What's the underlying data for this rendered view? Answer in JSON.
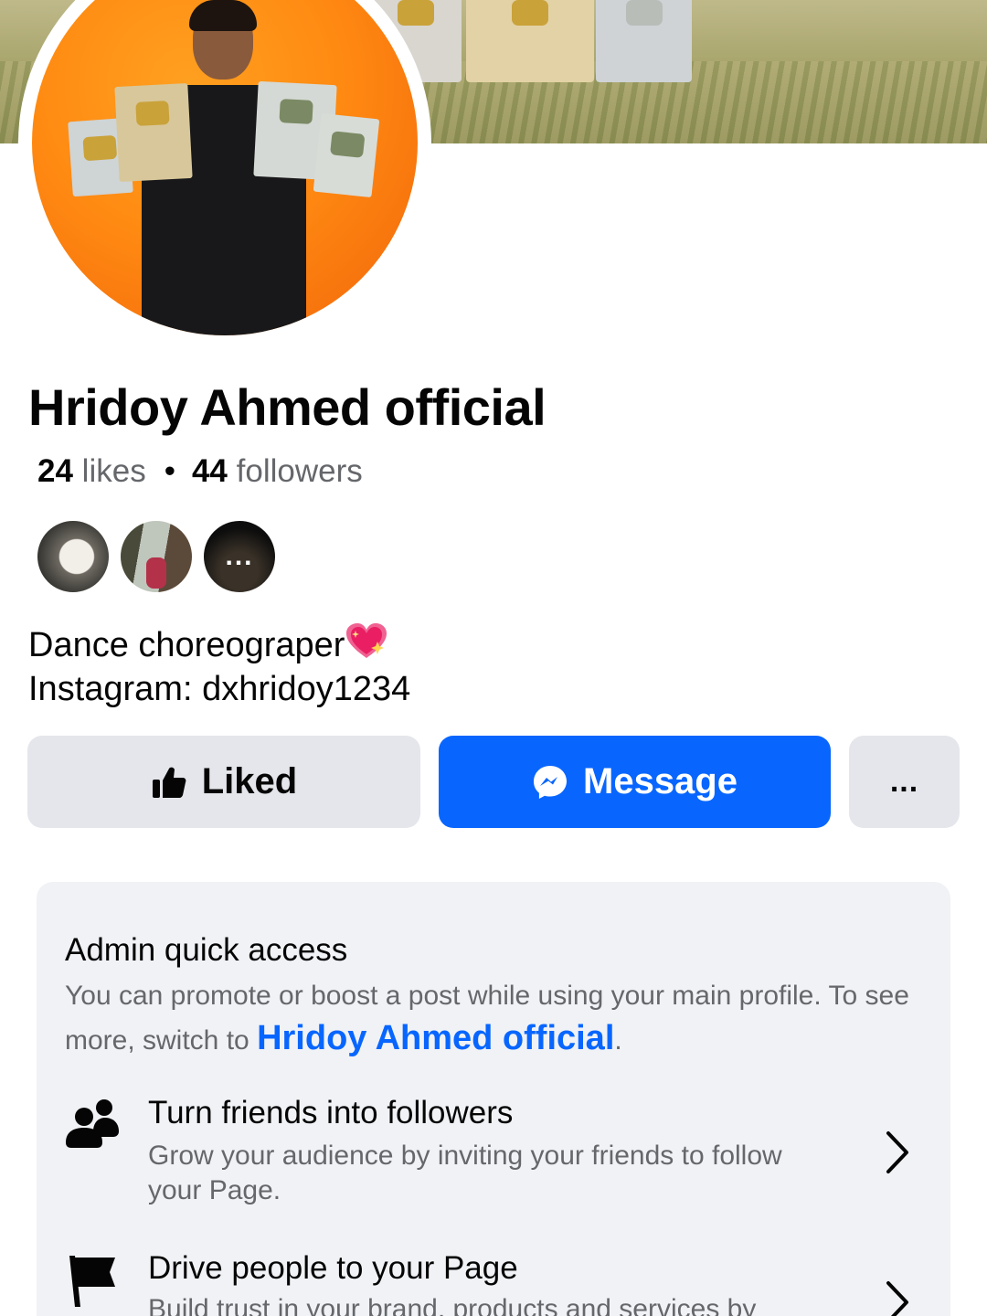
{
  "page": {
    "name": "Hridoy Ahmed official",
    "likes_count": "24",
    "likes_label": "likes",
    "followers_count": "44",
    "followers_label": "followers",
    "stat_separator": "•",
    "bio_line1": "Dance choreograper",
    "bio_line2": "Instagram: dxhridoy1234",
    "friends_more": "..."
  },
  "actions": {
    "liked_label": "Liked",
    "message_label": "Message",
    "more_label": "..."
  },
  "admin": {
    "title": "Admin quick access",
    "desc_text": "You can promote or boost a post while using your main profile. To see more, switch to",
    "desc_link": "Hridoy Ahmed official",
    "desc_end": ".",
    "items": [
      {
        "title": "Turn friends into followers",
        "desc": "Grow your audience by inviting your friends to follow your Page.",
        "icon": "people-icon"
      },
      {
        "title": "Drive people to your Page",
        "desc": "Build trust in your brand, products and services by",
        "icon": "flag-icon"
      }
    ]
  },
  "colors": {
    "accent": "#0866ff",
    "button_gray": "#e4e6eb",
    "card_bg": "#f0f2f5",
    "secondary_text": "#65676b",
    "avatar_orange": "#ff8a12"
  }
}
